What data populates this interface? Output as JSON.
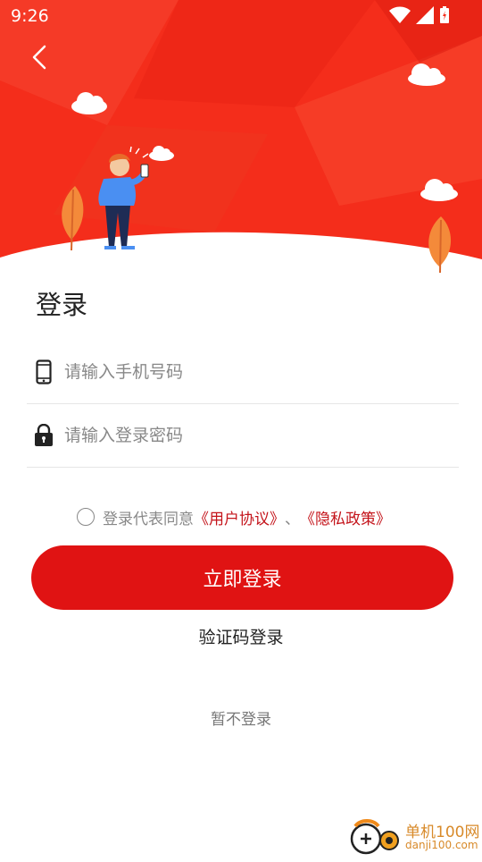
{
  "status_bar": {
    "time": "9:26"
  },
  "header": {
    "bg_color": "#f42d1b"
  },
  "login": {
    "title": "登录",
    "phone_placeholder": "请输入手机号码",
    "password_placeholder": "请输入登录密码",
    "agreement_prefix": "登录代表同意",
    "user_agreement": "《用户协议》",
    "separator": "、",
    "privacy_policy": "《隐私政策》",
    "login_button": "立即登录",
    "code_login": "验证码登录",
    "skip_login": "暂不登录"
  },
  "watermark": {
    "brand": "单机100网",
    "url": "danji100.com"
  },
  "colors": {
    "accent": "#e01313",
    "link": "#c4141b"
  }
}
